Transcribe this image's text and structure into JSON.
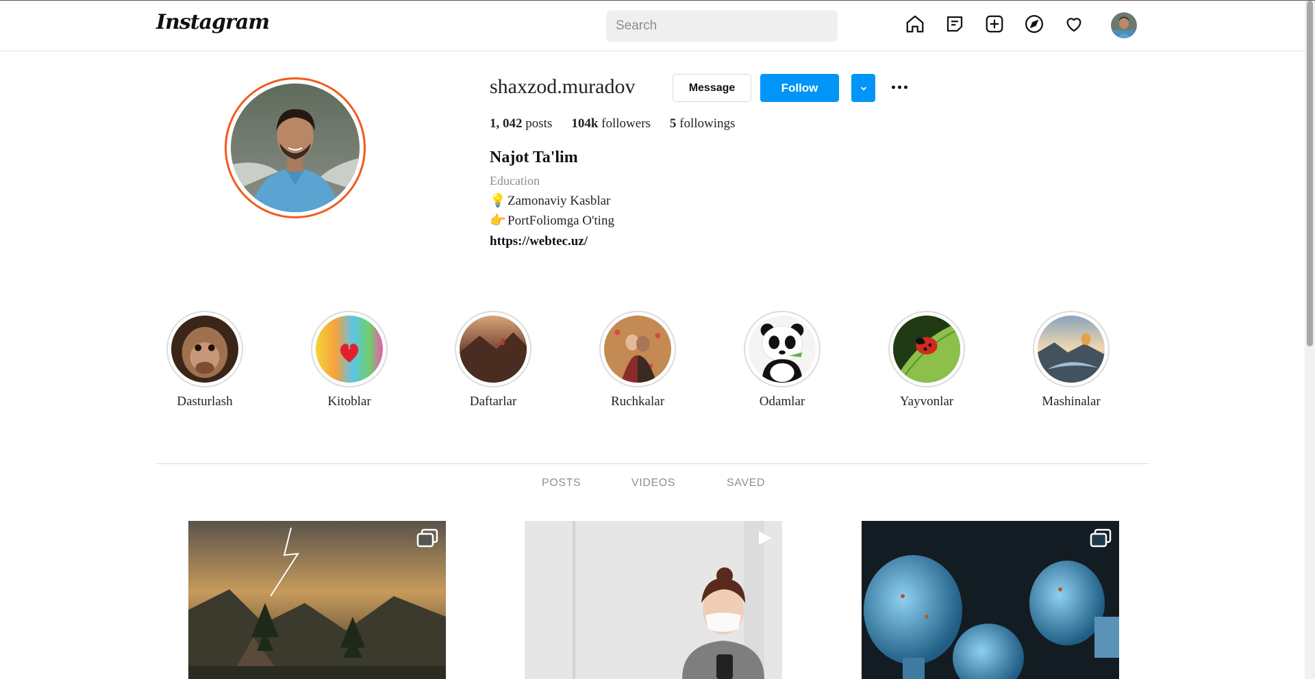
{
  "header": {
    "logo_text": "Instagram",
    "search_placeholder": "Search",
    "nav": [
      "home-icon",
      "messages-icon",
      "new-post-icon",
      "explore-icon",
      "activity-heart-icon",
      "profile-avatar"
    ]
  },
  "profile": {
    "username": "shaxzod.muradov",
    "message_label": "Message",
    "follow_label": "Follow",
    "stats": {
      "posts_count": "1, 042",
      "posts_label": "posts",
      "followers_count": "104k",
      "followers_label": "followers",
      "following_count": "5",
      "following_label": "followings"
    },
    "full_name": "Najot Ta'lim",
    "category": "Education",
    "bio": [
      {
        "emoji": "💡",
        "text": "Zamonaviy Kasblar"
      },
      {
        "emoji": "👉",
        "text": "PortFoliomga O'ting"
      }
    ],
    "link": "https://webtec.uz/"
  },
  "highlights": [
    {
      "label": "Dasturlash"
    },
    {
      "label": "Kitoblar"
    },
    {
      "label": "Daftarlar"
    },
    {
      "label": "Ruchkalar"
    },
    {
      "label": "Odamlar"
    },
    {
      "label": "Yayvonlar"
    },
    {
      "label": "Mashinalar"
    }
  ],
  "tabs": [
    "POSTS",
    "VIDEOS",
    "SAVED"
  ],
  "posts": [
    {
      "type": "carousel",
      "badge": "multiple-images-icon"
    },
    {
      "type": "video",
      "badge": "video-play-icon"
    },
    {
      "type": "carousel",
      "badge": "multiple-images-icon"
    }
  ],
  "colors": {
    "follow_blue": "#0095f6",
    "story_ring": "#f25a1c",
    "muted_text": "#8e8e8e"
  }
}
